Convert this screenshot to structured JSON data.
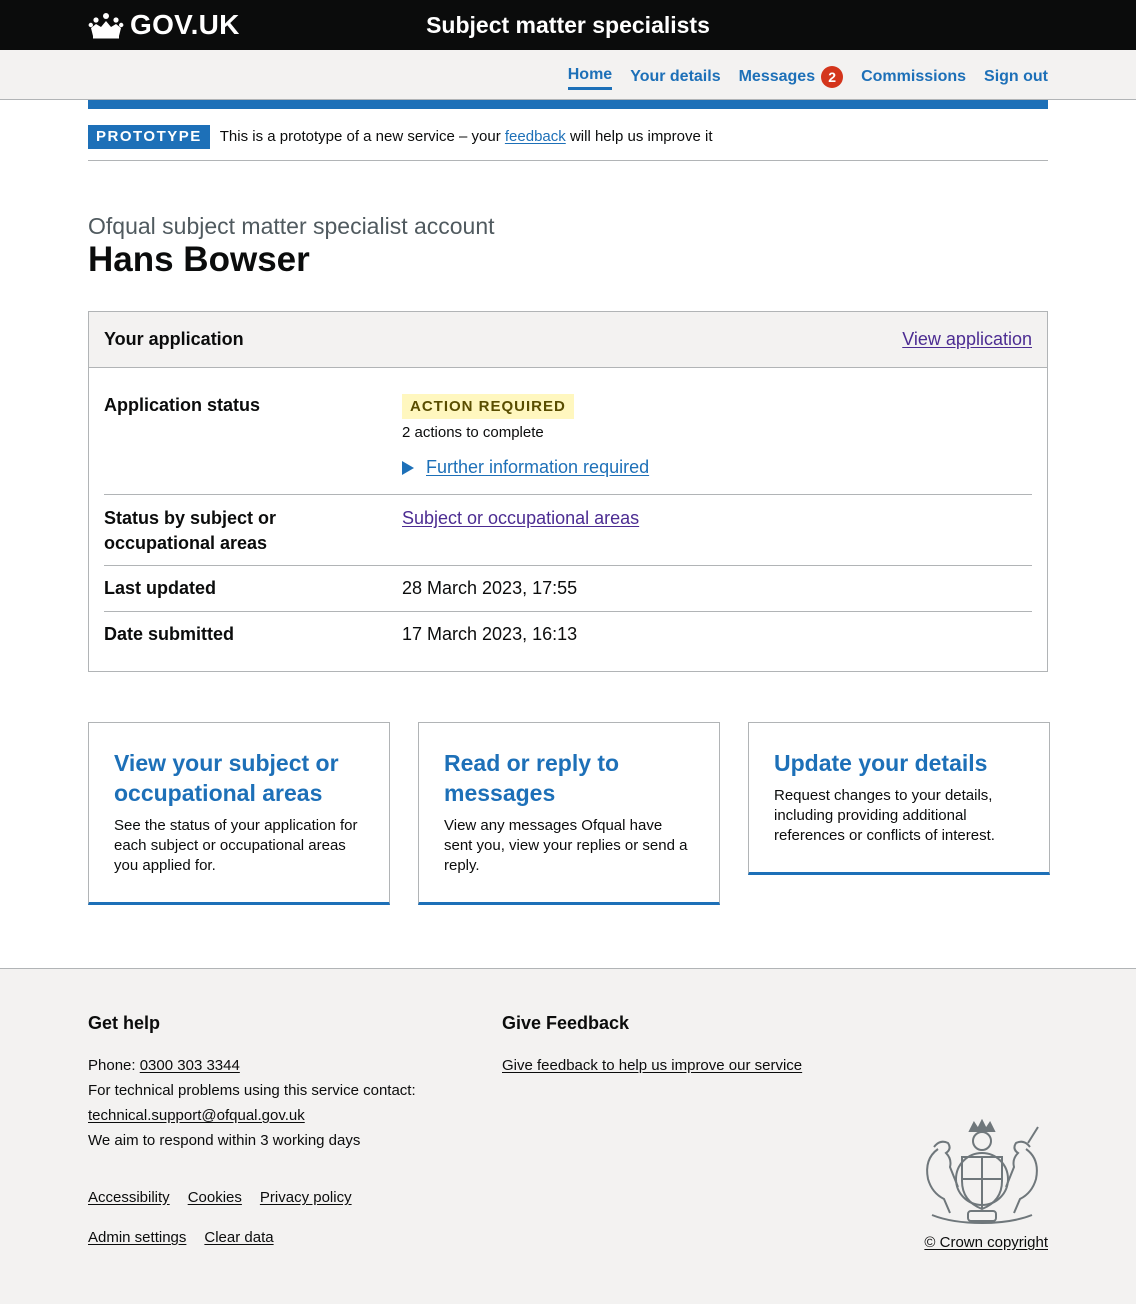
{
  "header": {
    "logo_text": "GOV.UK",
    "service_name": "Subject matter specialists"
  },
  "nav": {
    "items": [
      {
        "label": "Home",
        "active": true
      },
      {
        "label": "Your details"
      },
      {
        "label": "Messages",
        "badge": "2"
      },
      {
        "label": "Commissions"
      },
      {
        "label": "Sign out"
      }
    ]
  },
  "phase": {
    "tag": "PROTOTYPE",
    "text_before": "This is a prototype of a new service – your ",
    "link": "feedback",
    "text_after": " will help us improve it"
  },
  "page": {
    "caption": "Ofqual subject matter specialist account",
    "title": "Hans Bowser"
  },
  "application": {
    "title": "Your application",
    "view_link": "View application",
    "rows": {
      "status_key": "Application status",
      "status_tag": "ACTION REQUIRED",
      "status_actions": "2 actions to complete",
      "status_details": "Further information required",
      "subject_key": "Status by subject or occupational areas",
      "subject_link": "Subject or occupational areas",
      "updated_key": "Last updated",
      "updated_value": "28 March 2023, 17:55",
      "submitted_key": "Date submitted",
      "submitted_value": "17 March 2023, 16:13"
    }
  },
  "tiles": [
    {
      "title": "View your subject or occupational areas",
      "desc": "See the status of your application for each subject or occupational areas you applied for."
    },
    {
      "title": "Read or reply to messages",
      "desc": "View any messages Ofqual have sent you, view your replies or send a reply."
    },
    {
      "title": "Update your details",
      "desc": "Request changes to your details, including providing additional references or conflicts of interest."
    }
  ],
  "footer": {
    "help_title": "Get help",
    "phone_label": "Phone: ",
    "phone": "0300 303 3344",
    "tech_text": "For technical problems using this service contact:",
    "email": "technical.support@ofqual.gov.uk",
    "respond": "We aim to respond within 3 working days",
    "feedback_title": "Give Feedback",
    "feedback_link": "Give feedback to help us improve our service",
    "links": [
      "Accessibility",
      "Cookies",
      "Privacy policy"
    ],
    "links2": [
      "Admin settings",
      "Clear data"
    ],
    "copyright": "© Crown copyright"
  },
  "colors": {
    "brand_blue": "#1d70b8",
    "header_black": "#0b0c0c",
    "badge_red": "#d4351c",
    "tag_yellow_bg": "#fff7bf"
  }
}
